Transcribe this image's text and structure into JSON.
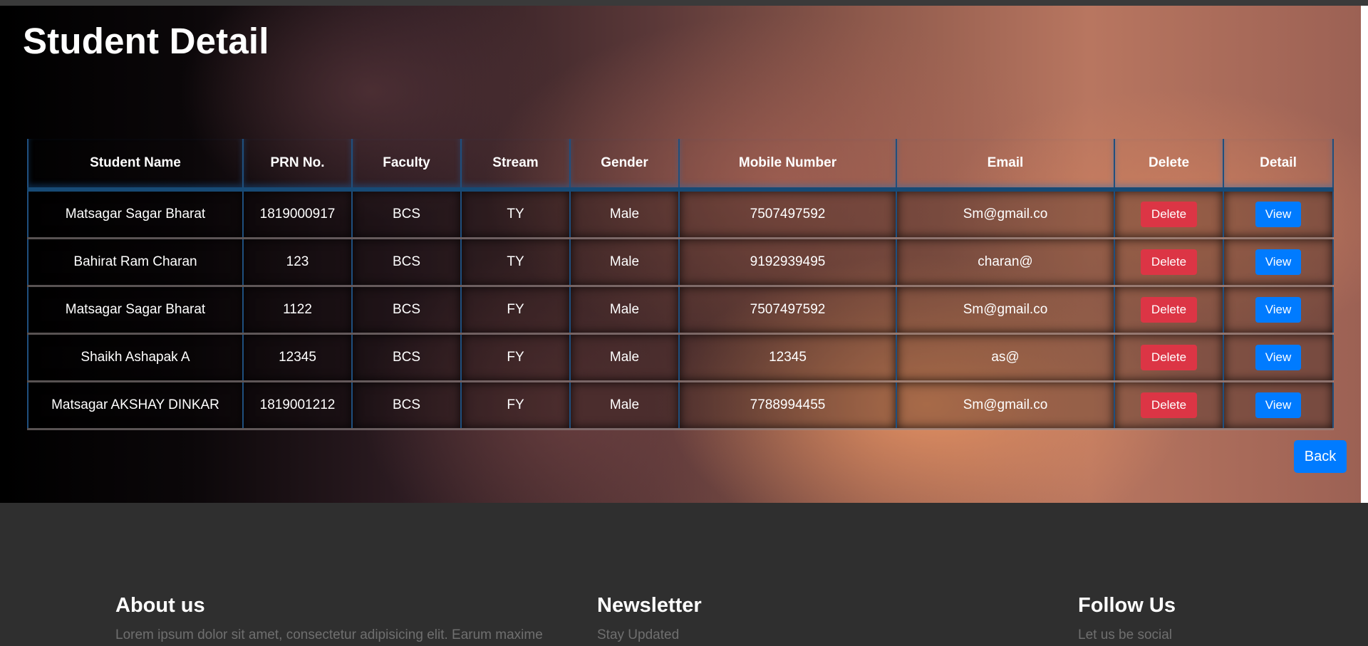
{
  "page": {
    "title": "Student Detail",
    "back_label": "Back"
  },
  "table": {
    "headers": [
      "Student Name",
      "PRN No.",
      "Faculty",
      "Stream",
      "Gender",
      "Mobile Number",
      "Email",
      "Delete",
      "Detail"
    ],
    "rows": [
      {
        "name": "Matsagar Sagar Bharat",
        "prn": "1819000917",
        "faculty": "BCS",
        "stream": "TY",
        "gender": "Male",
        "mobile": "7507497592",
        "email": "Sm@gmail.co",
        "delete_label": "Delete",
        "view_label": "View"
      },
      {
        "name": "Bahirat Ram Charan",
        "prn": "123",
        "faculty": "BCS",
        "stream": "TY",
        "gender": "Male",
        "mobile": "9192939495",
        "email": "charan@",
        "delete_label": "Delete",
        "view_label": "View"
      },
      {
        "name": "Matsagar Sagar Bharat",
        "prn": "1122",
        "faculty": "BCS",
        "stream": "FY",
        "gender": "Male",
        "mobile": "7507497592",
        "email": "Sm@gmail.co",
        "delete_label": "Delete",
        "view_label": "View"
      },
      {
        "name": "Shaikh Ashapak A",
        "prn": "12345",
        "faculty": "BCS",
        "stream": "FY",
        "gender": "Male",
        "mobile": "12345",
        "email": "as@",
        "delete_label": "Delete",
        "view_label": "View"
      },
      {
        "name": "Matsagar AKSHAY DINKAR",
        "prn": "1819001212",
        "faculty": "BCS",
        "stream": "FY",
        "gender": "Male",
        "mobile": "7788994455",
        "email": "Sm@gmail.co",
        "delete_label": "Delete",
        "view_label": "View"
      }
    ]
  },
  "footer": {
    "about": {
      "heading": "About us",
      "text": "Lorem ipsum dolor sit amet, consectetur adipisicing elit. Earum maxime"
    },
    "newsletter": {
      "heading": "Newsletter",
      "text": "Stay Updated"
    },
    "follow": {
      "heading": "Follow Us",
      "text": "Let us be social"
    }
  },
  "colors": {
    "delete_button": "#dc3545",
    "view_button": "#007bff",
    "back_button": "#007bff",
    "footer_bg": "#2f2f2f",
    "table_border": "#1f4f7e"
  }
}
